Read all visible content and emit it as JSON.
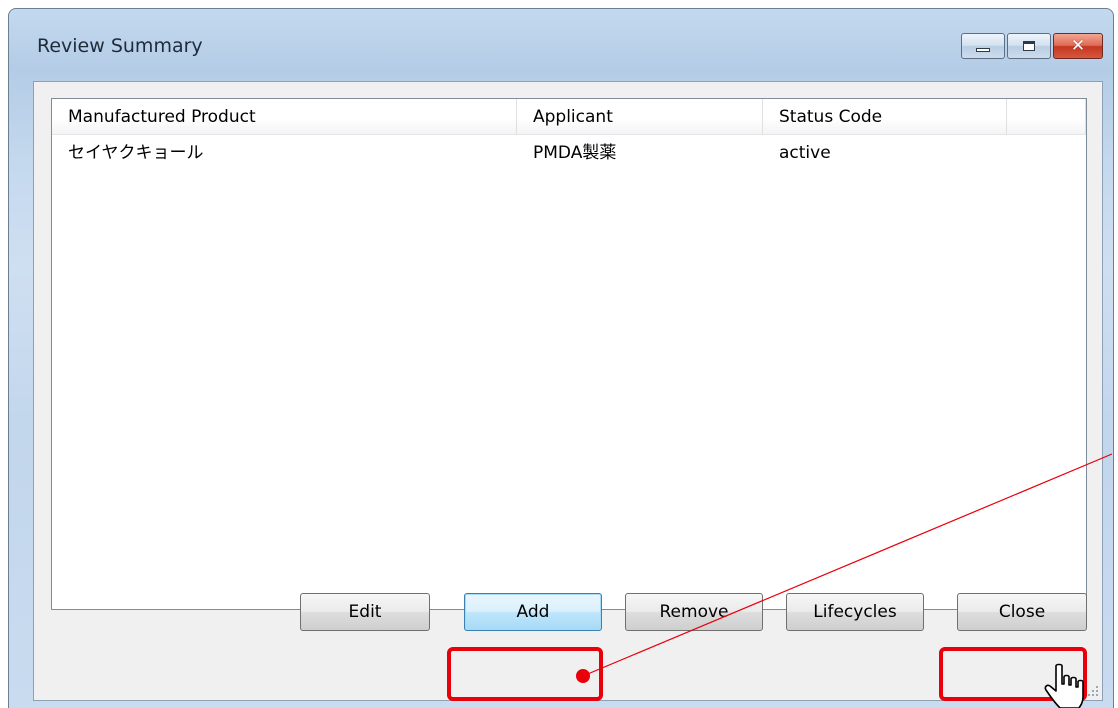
{
  "window": {
    "title": "Review Summary",
    "controls": {
      "minimize": "minimize-icon",
      "maximize": "maximize-icon",
      "close": "close-icon"
    }
  },
  "table": {
    "columns": [
      "Manufactured Product",
      "Applicant",
      "Status Code",
      ""
    ],
    "rows": [
      [
        "セイヤクキョール",
        "PMDA製薬",
        "active",
        ""
      ]
    ]
  },
  "buttons": {
    "edit": "Edit",
    "add": "Add",
    "remove": "Remove",
    "lifecycles": "Lifecycles",
    "close": "Close"
  },
  "annotations": {
    "highlight_color": "#e8000b",
    "cursor": "hand-pointer-icon"
  }
}
